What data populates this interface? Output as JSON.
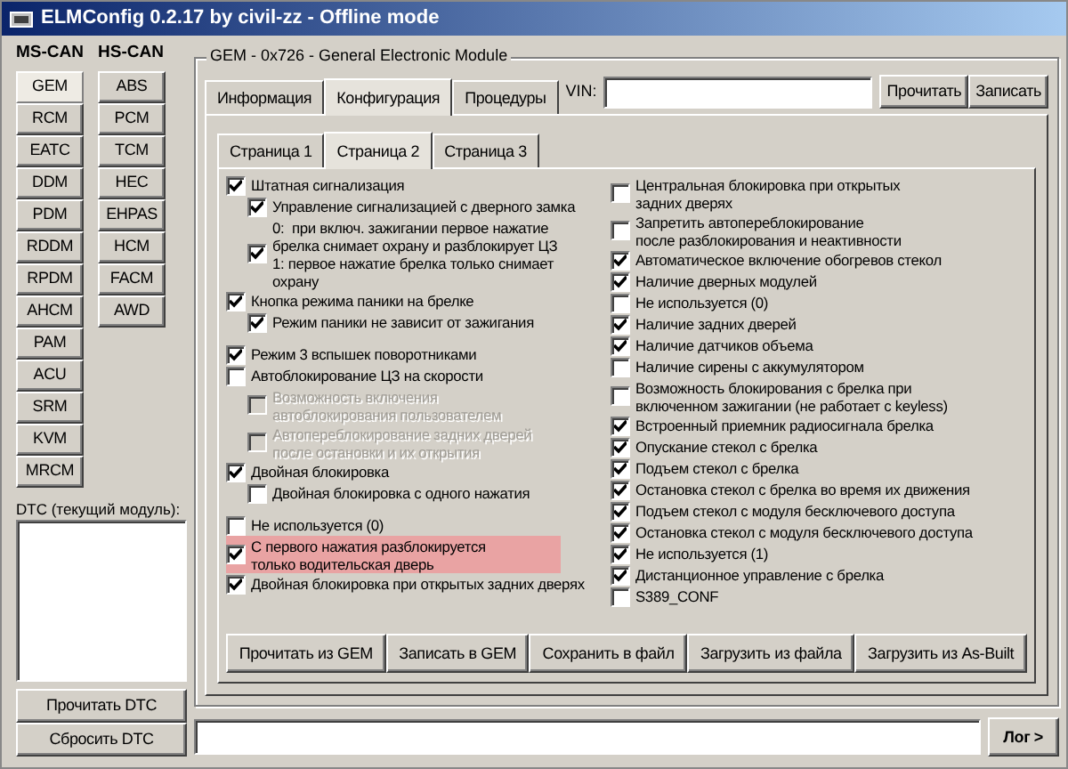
{
  "window": {
    "title": "ELMConfig 0.2.17 by civil-zz - Offline mode"
  },
  "buses": [
    {
      "label": "MS-CAN",
      "modules": [
        {
          "label": "GEM",
          "selected": true
        },
        {
          "label": "RCM",
          "selected": false
        },
        {
          "label": "EATC",
          "selected": false
        },
        {
          "label": "DDM",
          "selected": false
        },
        {
          "label": "PDM",
          "selected": false
        },
        {
          "label": "RDDM",
          "selected": false
        },
        {
          "label": "RPDM",
          "selected": false
        },
        {
          "label": "AHCM",
          "selected": false
        },
        {
          "label": "PAM",
          "selected": false
        },
        {
          "label": "ACU",
          "selected": false
        },
        {
          "label": "SRM",
          "selected": false
        },
        {
          "label": "KVM",
          "selected": false
        },
        {
          "label": "MRCM",
          "selected": false
        }
      ]
    },
    {
      "label": "HS-CAN",
      "modules": [
        {
          "label": "ABS",
          "selected": false
        },
        {
          "label": "PCM",
          "selected": false
        },
        {
          "label": "TCM",
          "selected": false
        },
        {
          "label": "HEC",
          "selected": false
        },
        {
          "label": "EHPAS",
          "selected": false
        },
        {
          "label": "HCM",
          "selected": false
        },
        {
          "label": "FACM",
          "selected": false
        },
        {
          "label": "AWD",
          "selected": false
        }
      ]
    }
  ],
  "dtc": {
    "label": "DTC (текущий модуль):",
    "buttons": [
      "Прочитать DTC",
      "Сбросить DTC"
    ]
  },
  "module_group": {
    "title": "GEM - 0x726 - General Electronic Module"
  },
  "tabs": [
    {
      "label": "Информация",
      "selected": false
    },
    {
      "label": "Конфигурация",
      "selected": true
    },
    {
      "label": "Процедуры",
      "selected": false
    }
  ],
  "vin": {
    "label": "VIN:",
    "buttons": [
      "Прочитать",
      "Записать"
    ]
  },
  "pages": [
    {
      "label": "Страница 1",
      "selected": false
    },
    {
      "label": "Страница 2",
      "selected": true
    },
    {
      "label": "Страница 3",
      "selected": false
    }
  ],
  "options": {
    "left": [
      [
        {
          "label": "Штатная сигнализация",
          "checked": true,
          "disabled": false,
          "highlighted": false,
          "children": [
            {
              "label": "Управление сигнализацией с дверного замка",
              "checked": true,
              "disabled": false,
              "highlighted": false
            },
            {
              "label": "0:  при включ. зажигании первое нажатие\nбрелка снимает охрану и разблокирует ЦЗ\n1: первое нажатие брелка только снимает\nохрану",
              "checked": true,
              "disabled": false,
              "highlighted": false
            }
          ]
        },
        {
          "label": "Кнопка режима паники на брелке",
          "checked": true,
          "disabled": false,
          "highlighted": false,
          "children": [
            {
              "label": "Режим паники не зависит от зажигания",
              "checked": true,
              "disabled": false,
              "highlighted": false
            }
          ]
        }
      ],
      [
        {
          "label": "Режим 3 вспышек поворотниками",
          "checked": true,
          "disabled": false,
          "highlighted": false
        },
        {
          "label": "Автоблокирование ЦЗ на скорости",
          "checked": false,
          "disabled": false,
          "highlighted": false,
          "children": [
            {
              "label": "Возможность включения\nавтоблокирования пользователем",
              "checked": false,
              "disabled": true,
              "highlighted": false
            },
            {
              "label": "Автопереблокирование задних дверей\nпосле остановки и их открытия",
              "checked": false,
              "disabled": true,
              "highlighted": false
            }
          ]
        },
        {
          "label": "Двойная блокировка",
          "checked": true,
          "disabled": false,
          "highlighted": false,
          "children": [
            {
              "label": "Двойная блокировка с одного нажатия",
              "checked": false,
              "disabled": false,
              "highlighted": false
            }
          ]
        }
      ],
      [
        {
          "label": "Не используется (0)",
          "checked": false,
          "disabled": false,
          "highlighted": false
        },
        {
          "label": "С первого нажатия разблокируется\nтолько водительская дверь",
          "checked": true,
          "disabled": false,
          "highlighted": true
        },
        {
          "label": "Двойная блокировка при открытых задних дверях",
          "checked": true,
          "disabled": false,
          "highlighted": false
        }
      ]
    ],
    "right": [
      [
        {
          "label": "Центральная блокировка при открытых\nзадних дверях",
          "checked": false,
          "disabled": false,
          "highlighted": false
        },
        {
          "label": "Запретить автопереблокирование\nпосле разблокирования и неактивности",
          "checked": false,
          "disabled": false,
          "highlighted": false
        },
        {
          "label": "Автоматическое включение обогревов стекол",
          "checked": true,
          "disabled": false,
          "highlighted": false
        },
        {
          "label": "Наличие дверных модулей",
          "checked": true,
          "disabled": false,
          "highlighted": false
        },
        {
          "label": "Не используется (0)",
          "checked": false,
          "disabled": false,
          "highlighted": false
        },
        {
          "label": "Наличие задних дверей",
          "checked": true,
          "disabled": false,
          "highlighted": false
        },
        {
          "label": "Наличие датчиков объема",
          "checked": true,
          "disabled": false,
          "highlighted": false
        },
        {
          "label": "Наличие сирены с аккумулятором",
          "checked": false,
          "disabled": false,
          "highlighted": false
        },
        {
          "label": "Возможность блокирования с брелка при\nвключенном зажигании (не работает с keyless)",
          "checked": false,
          "disabled": false,
          "highlighted": false
        },
        {
          "label": "Встроенный приемник радиосигнала брелка",
          "checked": true,
          "disabled": false,
          "highlighted": false
        },
        {
          "label": "Опускание стекол с брелка",
          "checked": true,
          "disabled": false,
          "highlighted": false
        },
        {
          "label": "Подъем стекол с брелка",
          "checked": true,
          "disabled": false,
          "highlighted": false
        },
        {
          "label": "Остановка стекол с брелка во время их движения",
          "checked": true,
          "disabled": false,
          "highlighted": false
        },
        {
          "label": "Подъем стекол с модуля бесключевого доступа",
          "checked": true,
          "disabled": false,
          "highlighted": false
        },
        {
          "label": "Остановка стекол с модуля бесключевого доступа",
          "checked": true,
          "disabled": false,
          "highlighted": false
        },
        {
          "label": "Не используется (1)",
          "checked": true,
          "disabled": false,
          "highlighted": false
        },
        {
          "label": "Дистанционное управление с брелка",
          "checked": true,
          "disabled": false,
          "highlighted": false
        },
        {
          "label": "S389_CONF",
          "checked": false,
          "disabled": false,
          "highlighted": false
        }
      ]
    ]
  },
  "actions": [
    "Прочитать из GEM",
    "Записать в GEM",
    "Сохранить в файл",
    "Загрузить из файла",
    "Загрузить из As-Built"
  ],
  "log": {
    "button": "Лог >"
  }
}
